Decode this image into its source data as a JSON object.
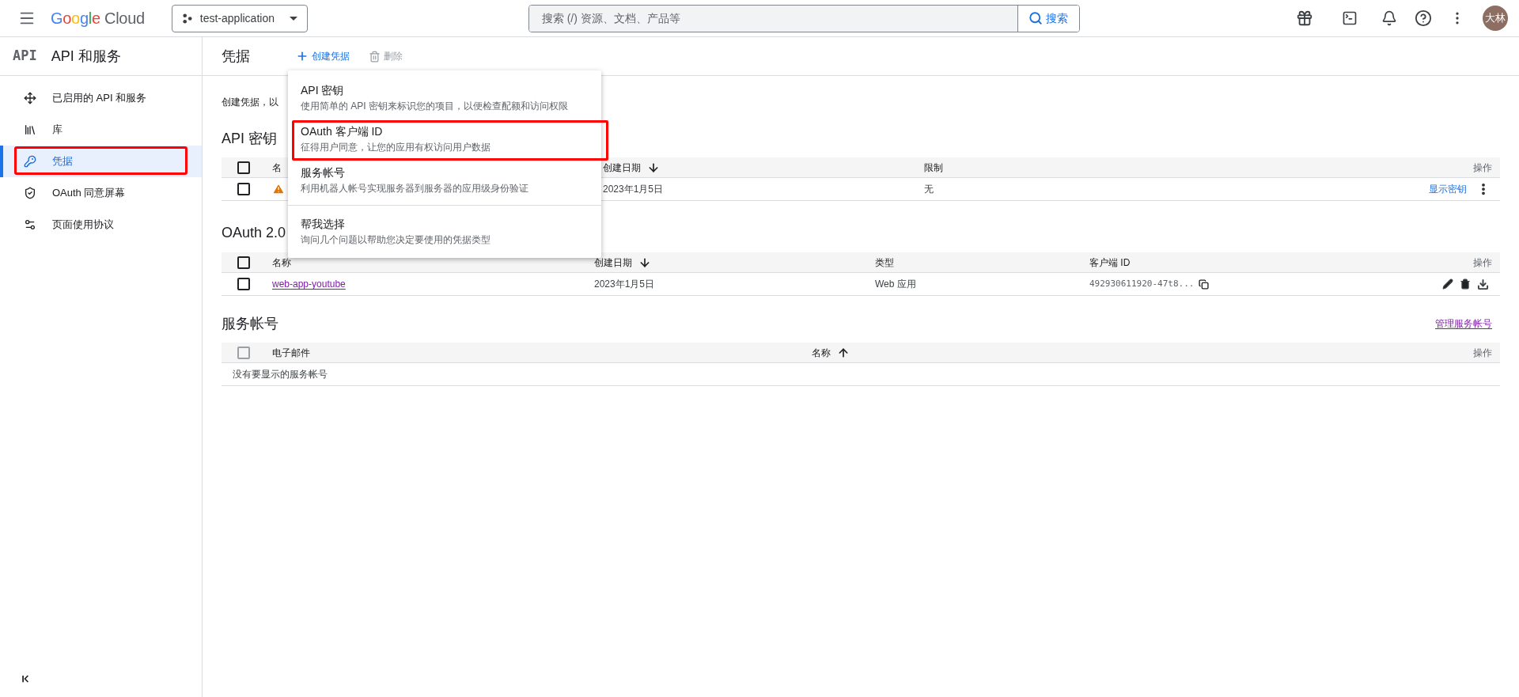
{
  "header": {
    "logo": "Google Cloud",
    "project": "test-application",
    "search": {
      "placeholder": "搜索 (/) 资源、文档、产品等"
    },
    "search_button": "搜索",
    "avatar": "大林"
  },
  "sidebar": {
    "badge": "API",
    "title": "API 和服务",
    "items": [
      {
        "label": "已启用的 API 和服务",
        "selected": false,
        "annotated": false
      },
      {
        "label": "库",
        "selected": false,
        "annotated": false
      },
      {
        "label": "凭据",
        "selected": true,
        "annotated": true
      },
      {
        "label": "OAuth 同意屏幕",
        "selected": false,
        "annotated": false
      },
      {
        "label": "页面使用协议",
        "selected": false,
        "annotated": false
      }
    ]
  },
  "toolbar": {
    "title": "凭据",
    "create": "创建凭据",
    "delete": {
      "label": "删除",
      "disabled": true
    }
  },
  "description": "创建凭据，以",
  "api_keys": {
    "heading": "API 密钥",
    "header_checked": false,
    "columns": [
      {
        "label": "名",
        "sorted": false
      },
      {
        "label": "创建日期",
        "sorted": true,
        "descending": true
      },
      {
        "label": "限制",
        "sorted": false
      },
      {
        "label": "操作",
        "sorted": false
      }
    ],
    "rows": [
      {
        "checked": false,
        "warning": true,
        "date": "2023年1月5日",
        "restriction": "无",
        "action": "显示密钥"
      }
    ]
  },
  "oauth": {
    "heading": "OAuth 2.0",
    "columns": [
      {
        "label": "名称",
        "sorted": false
      },
      {
        "label": "创建日期",
        "sorted": true,
        "descending": true
      },
      {
        "label": "类型",
        "sorted": false
      },
      {
        "label": "客户端 ID",
        "sorted": false
      },
      {
        "label": "操作",
        "sorted": false
      }
    ],
    "header_checked": false,
    "rows": [
      {
        "checked": false,
        "name": "web-app-youtube",
        "date": "2023年1月5日",
        "type": "Web 应用",
        "client_id": "492930611920-47t8..."
      }
    ]
  },
  "service_accounts": {
    "heading": "服务帐号",
    "manage_link": "管理服务帐号",
    "columns": [
      {
        "label": "电子邮件",
        "sorted": false
      },
      {
        "label": "名称",
        "sorted": true,
        "descending": false
      },
      {
        "label": "操作",
        "sorted": false
      }
    ],
    "header_checked": false,
    "header_disabled": true,
    "empty": "没有要显示的服务帐号"
  },
  "menu": {
    "items": [
      {
        "title": "API 密钥",
        "description": "使用简单的 API 密钥来标识您的项目，以便检查配额和访问权限",
        "annotated": false,
        "divider_before": false
      },
      {
        "title": "OAuth 客户端 ID",
        "description": "征得用户同意，让您的应用有权访问用户数据",
        "annotated": true,
        "divider_before": false
      },
      {
        "title": "服务帐号",
        "description": "利用机器人帐号实现服务器到服务器的应用级身份验证",
        "annotated": false,
        "divider_before": false
      },
      {
        "title": "帮我选择",
        "description": "询问几个问题以帮助您决定要使用的凭据类型",
        "annotated": false,
        "divider_before": true
      }
    ]
  }
}
